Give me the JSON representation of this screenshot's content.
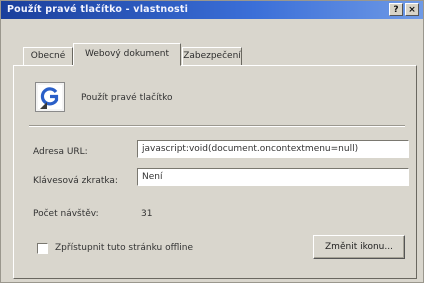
{
  "window": {
    "title": "Použít pravé tlačítko - vlastnosti",
    "help_label": "?",
    "close_label": "×"
  },
  "tabs": [
    {
      "label": "Obecné",
      "active": false
    },
    {
      "label": "Webový dokument",
      "active": true
    },
    {
      "label": "Zabezpečení",
      "active": false
    }
  ],
  "item": {
    "icon": "internet-shortcut-icon",
    "name": "Použít pravé tlačítko"
  },
  "form": {
    "url_label": "Adresa URL:",
    "url_value": "javascript:void(document.oncontextmenu=null)",
    "shortcut_label": "Klávesová zkratka:",
    "shortcut_value": "Není",
    "visits_label": "Počet návštěv:",
    "visits_value": "31",
    "offline_label": "Zpřístupnit tuto stránku offline",
    "offline_checked": false,
    "change_icon_label": "Změnit ikonu..."
  },
  "colors": {
    "titlebar_start": "#1a3f9c",
    "titlebar_end": "#6f9ae6",
    "dialog_face": "#d9d6cd"
  }
}
